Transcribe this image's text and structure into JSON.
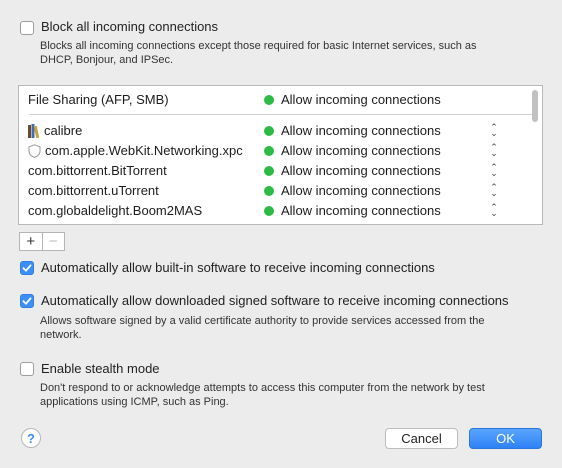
{
  "block": {
    "label": "Block all incoming connections",
    "checked": false,
    "description_line1": "Blocks all incoming connections except those required for basic Internet services,  such as",
    "description_line2": "DHCP, Bonjour, and IPSec."
  },
  "list": {
    "header": {
      "name": "File Sharing (AFP, SMB)",
      "status": "Allow incoming connections"
    },
    "rows": [
      {
        "name": "calibre",
        "status": "Allow incoming connections",
        "icon": "books-icon"
      },
      {
        "name": "com.apple.WebKit.Networking.xpc",
        "status": "Allow incoming connections",
        "icon": "shield-icon"
      },
      {
        "name": "com.bittorrent.BitTorrent",
        "status": "Allow incoming connections"
      },
      {
        "name": "com.bittorrent.uTorrent",
        "status": "Allow incoming connections"
      },
      {
        "name": "com.globaldelight.Boom2MAS",
        "status": "Allow incoming connections"
      }
    ],
    "status_color": "#2dbb45"
  },
  "segmented": {
    "plus": "+",
    "minus": "−"
  },
  "auto_builtin": {
    "label": "Automatically allow built-in software to receive incoming connections",
    "checked": true
  },
  "auto_signed": {
    "label": "Automatically allow downloaded signed software to receive incoming connections",
    "checked": true,
    "description_line1": "Allows software signed by a valid certificate authority to provide services accessed from the",
    "description_line2": "network."
  },
  "stealth": {
    "label": "Enable stealth mode",
    "checked": false,
    "description_line1": "Don't respond to or acknowledge attempts to access this computer from the network by test",
    "description_line2": "applications using ICMP, such as Ping."
  },
  "footer": {
    "help": "?",
    "cancel": "Cancel",
    "ok": "OK"
  },
  "colors": {
    "accent": "#3d8ff5",
    "background": "#ececec"
  }
}
